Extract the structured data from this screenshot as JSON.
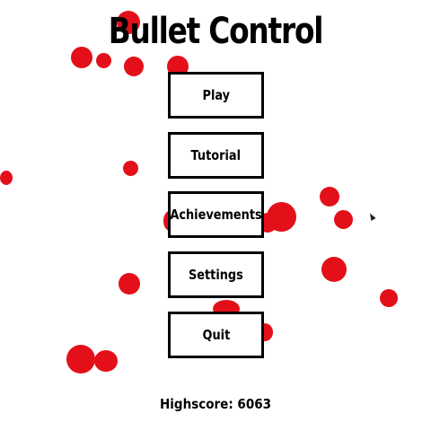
{
  "game": {
    "title": "Bullet Control",
    "menu": {
      "play_label": "Play",
      "tutorial_label": "Tutorial",
      "achievements_label": "Achievements",
      "settings_label": "Settings",
      "quit_label": "Quit"
    },
    "highscore_text": "Highscore: 6063"
  },
  "colors": {
    "bullet": "#e3101a",
    "background": "#ffffff",
    "text": "#000000"
  }
}
